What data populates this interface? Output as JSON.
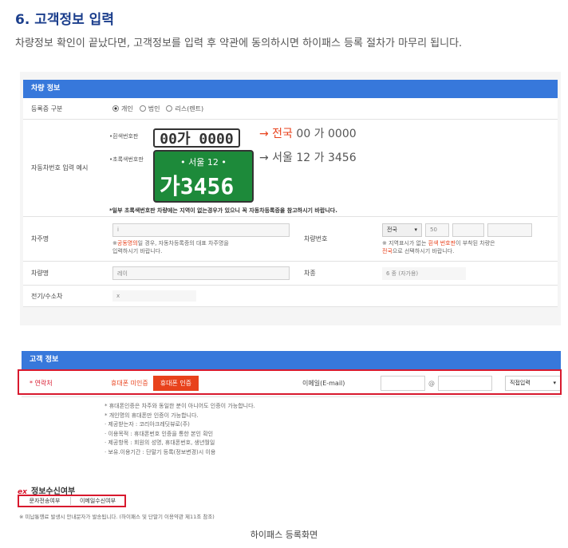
{
  "page": {
    "title": "6. 고객정보 입력",
    "subtitle": "차량정보 확인이 끝났다면, 고객정보를 입력 후 약관에 동의하시면 하이패스 등록 절차가 마무리 됩니다.",
    "caption": "하이패스 등록화면"
  },
  "vehicle": {
    "header": "차량 정보",
    "reg_type_label": "등록증 구분",
    "reg_options": [
      "개인",
      "법인",
      "리스(렌트)"
    ],
    "plate_example_label": "자동차번호 입력 예시",
    "white_plate_label": "•흰색번호판",
    "white_plate": "00가 0000",
    "white_plate_result_prefix": "→ 전국",
    "white_plate_result": "00 가 0000",
    "green_plate_label": "•초록색번호판",
    "green_plate_top": "•  서울 12  •",
    "green_plate_bottom": "가3456",
    "green_plate_result": "→ 서울  12  가  3456",
    "plate_note": "*일부 초록색번호판 차량에는 지역이 없는경우가 있으니 꼭 자동차등록증을 참고하시기 바랍니다.",
    "owner_label": "차주명",
    "owner_value": "i",
    "owner_note_prefix": "※",
    "owner_note_red": "공동명의",
    "owner_note_rest": "일 경우, 자동차등록증의 대표 차주명을",
    "owner_note_2": "입력하시기 바랍니다.",
    "carno_label": "차량번호",
    "carno_region": "전국",
    "carno_num": "50",
    "carno_note_1a": "※ 지역표시가 없는",
    "carno_note_1red": "흰색 번호판",
    "carno_note_1b": "이 부착된 차량은",
    "carno_note_2red": "전국",
    "carno_note_2b": "으로 선택하시기 바랍니다.",
    "model_label": "차량명",
    "model_value": "레이",
    "kind_label": "차종",
    "kind_value": "6 종 (자가용)",
    "ev_label": "전기/수소차",
    "ev_value": "x"
  },
  "customer": {
    "header": "고객 정보",
    "contact_label": "* 연락처",
    "unverified": "휴대폰 미인증",
    "verify_button": "휴대폰 인증",
    "email_label": "이메일(E-mail)",
    "at": "@",
    "email_select": "직접입력",
    "notes": [
      "* 휴대폰인증은 차주와 동일한 분이 아니어도 인증이 가능합니다.",
      "* 개인명의 휴대폰만 인증이 가능합니다.",
      "· 제공받는자 : 코리아크레딧뷰로(주)",
      "· 이용목적 : 휴대폰번호 인증을 통한 본인 확인",
      "· 제공항목 : 회원의 성명, 휴대폰번호, 생년월일",
      "· 보유.이용기간 : 단말기 등록(정보변경)시 이용"
    ]
  },
  "consent": {
    "title": "정보수신여부",
    "sms": "문자전송여부",
    "email": "이메일수신여부",
    "footnote": "※ 미납통행료 발생시 안내문자가 발송됩니다. (하이패스 및 단말기 이용약관 제11조 참조)"
  },
  "colors": {
    "header_blue": "#3778db",
    "accent_red": "#e8421c",
    "highlight": "#d8192e",
    "plate_green": "#1d8a3a"
  }
}
